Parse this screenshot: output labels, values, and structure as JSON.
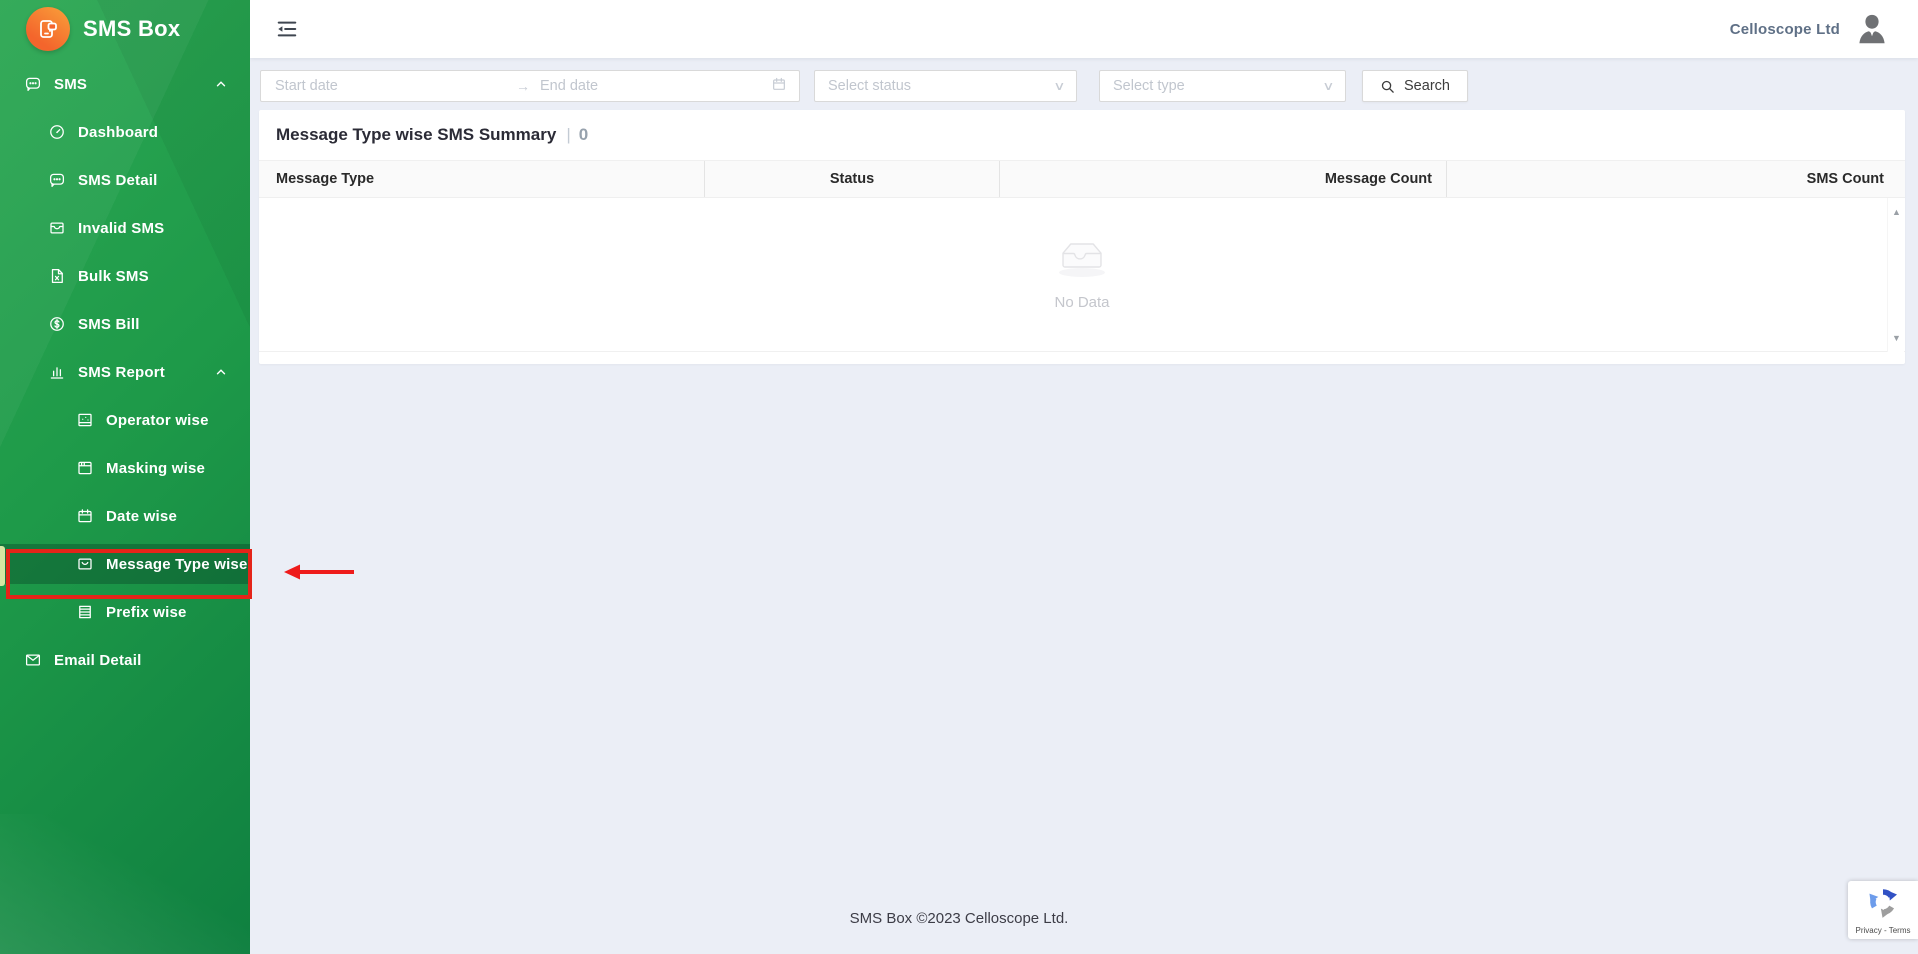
{
  "app": {
    "title": "SMS Box"
  },
  "header": {
    "org": "Celloscope Ltd"
  },
  "sidebar": {
    "items": [
      {
        "label": "SMS",
        "level": 1,
        "icon": "chat-icon",
        "expanded": true
      },
      {
        "label": "Dashboard",
        "level": 2,
        "icon": "dashboard-icon"
      },
      {
        "label": "SMS Detail",
        "level": 2,
        "icon": "chat-icon"
      },
      {
        "label": "Invalid SMS",
        "level": 2,
        "icon": "inbox-icon"
      },
      {
        "label": "Bulk SMS",
        "level": 2,
        "icon": "file-icon"
      },
      {
        "label": "SMS Bill",
        "level": 2,
        "icon": "dollar-icon"
      },
      {
        "label": "SMS Report",
        "level": 2,
        "icon": "bar-chart-icon",
        "expanded": true
      },
      {
        "label": "Operator wise",
        "level": 3,
        "icon": "chart-box-icon"
      },
      {
        "label": "Masking wise",
        "level": 3,
        "icon": "window-icon"
      },
      {
        "label": "Date wise",
        "level": 3,
        "icon": "calendar-icon"
      },
      {
        "label": "Message Type wise",
        "level": 3,
        "icon": "mail-open-icon",
        "active": true
      },
      {
        "label": "Prefix wise",
        "level": 3,
        "icon": "list-icon"
      },
      {
        "label": "Email Detail",
        "level": 1,
        "icon": "mail-icon"
      }
    ]
  },
  "filters": {
    "start_placeholder": "Start date",
    "end_placeholder": "End date",
    "range_arrow": "→",
    "status_placeholder": "Select status",
    "type_placeholder": "Select type",
    "search_label": "Search"
  },
  "summary": {
    "title": "Message Type wise SMS Summary",
    "separator": "|",
    "count": "0"
  },
  "table": {
    "columns": [
      "Message Type",
      "Status",
      "Message Count",
      "SMS Count"
    ],
    "empty_label": "No Data",
    "scroll_up": "▲",
    "scroll_down": "▼"
  },
  "footer": {
    "copyright": "SMS Box ©2023 Celloscope Ltd."
  },
  "recaptcha": {
    "label": "Privacy - Terms"
  },
  "colors": {
    "sidebar_green": "#1e9a49",
    "active_item": "#3f7f60",
    "logo_orange": "#f4652c",
    "annotation_red": "#e42419",
    "page_bg": "#ebeef6"
  }
}
